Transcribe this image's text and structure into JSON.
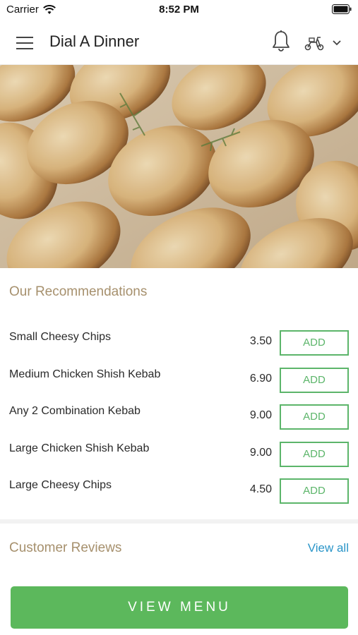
{
  "status_bar": {
    "carrier": "Carrier",
    "time": "8:52 PM"
  },
  "header": {
    "title": "Dial A Dinner",
    "menu_icon": "hamburger-menu-icon",
    "notification_icon": "bell-icon",
    "delivery_icon": "scooter-icon",
    "dropdown_icon": "chevron-down-icon"
  },
  "hero": {
    "image": "chicken-shish-kebab-photo"
  },
  "recommendations": {
    "title": "Our Recommendations",
    "add_label": "ADD",
    "items": [
      {
        "name": "Small Cheesy Chips",
        "price": "3.50"
      },
      {
        "name": "Medium Chicken Shish Kebab",
        "price": "6.90"
      },
      {
        "name": "Any 2 Combination Kebab",
        "price": "9.00"
      },
      {
        "name": "Large Chicken Shish Kebab",
        "price": "9.00"
      },
      {
        "name": "Large Cheesy Chips",
        "price": "4.50"
      }
    ]
  },
  "reviews": {
    "title": "Customer Reviews",
    "view_all": "View all"
  },
  "footer": {
    "view_menu": "VIEW MENU"
  },
  "colors": {
    "accent_green": "#5cb85c",
    "section_title": "#a6906d",
    "link_blue": "#2a95c8"
  }
}
